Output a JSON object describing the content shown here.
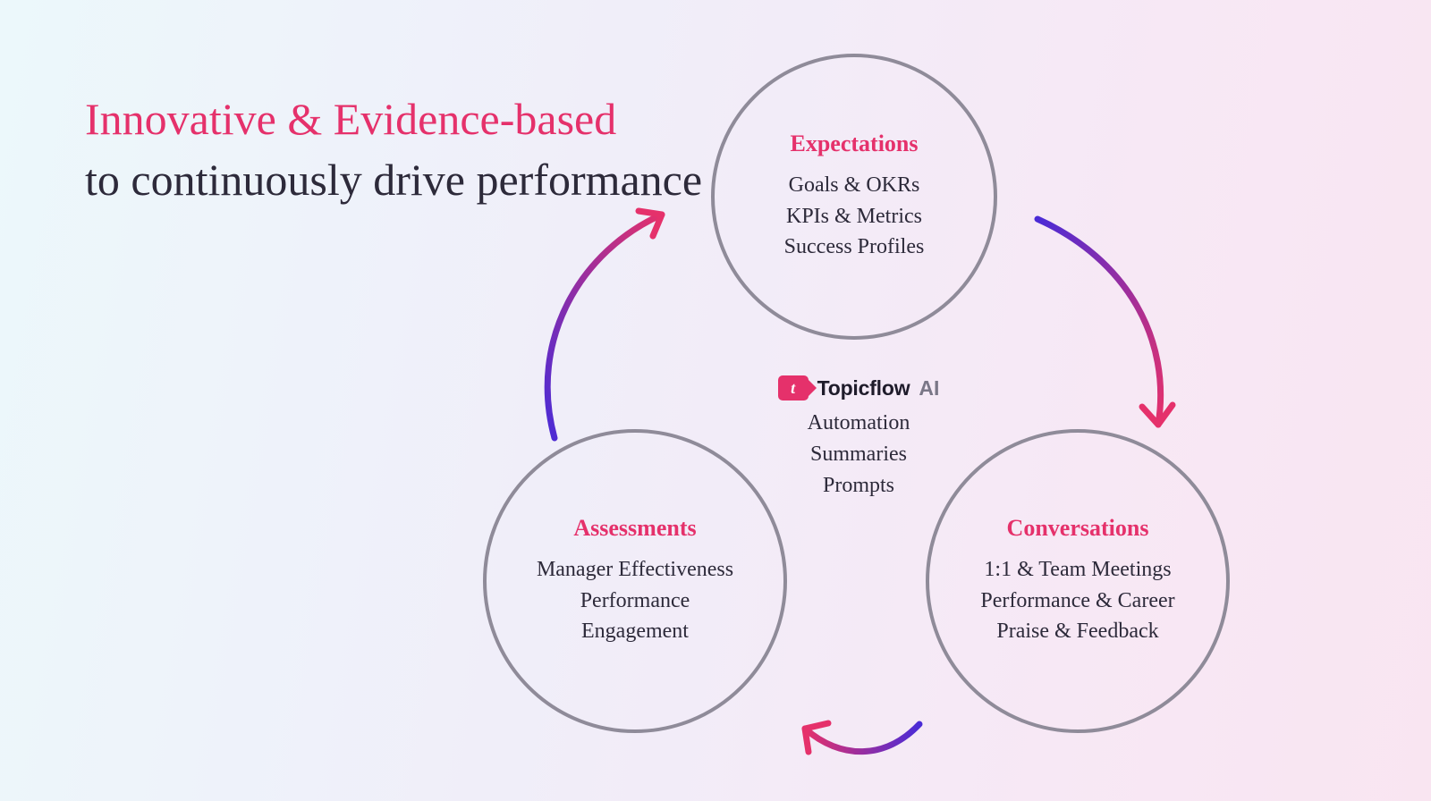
{
  "headline": {
    "accent": "Innovative & Evidence-based",
    "rest": "to continuously drive performance"
  },
  "center": {
    "logo_letter": "t",
    "logo_name": "Topicflow",
    "logo_ai": "AI",
    "items": [
      "Automation",
      "Summaries",
      "Prompts"
    ]
  },
  "nodes": {
    "expectations": {
      "title": "Expectations",
      "items": [
        "Goals & OKRs",
        "KPIs & Metrics",
        "Success Profiles"
      ]
    },
    "conversations": {
      "title": "Conversations",
      "items": [
        "1:1 & Team Meetings",
        "Performance & Career",
        "Praise & Feedback"
      ]
    },
    "assessments": {
      "title": "Assessments",
      "items": [
        "Manager Effectiveness",
        "Performance",
        "Engagement"
      ]
    }
  },
  "colors": {
    "accent": "#e5316b",
    "text": "#2d2a3a",
    "circle_border": "#8f8b99",
    "grad_start": "#4a2bd6",
    "grad_end": "#e5316b"
  }
}
